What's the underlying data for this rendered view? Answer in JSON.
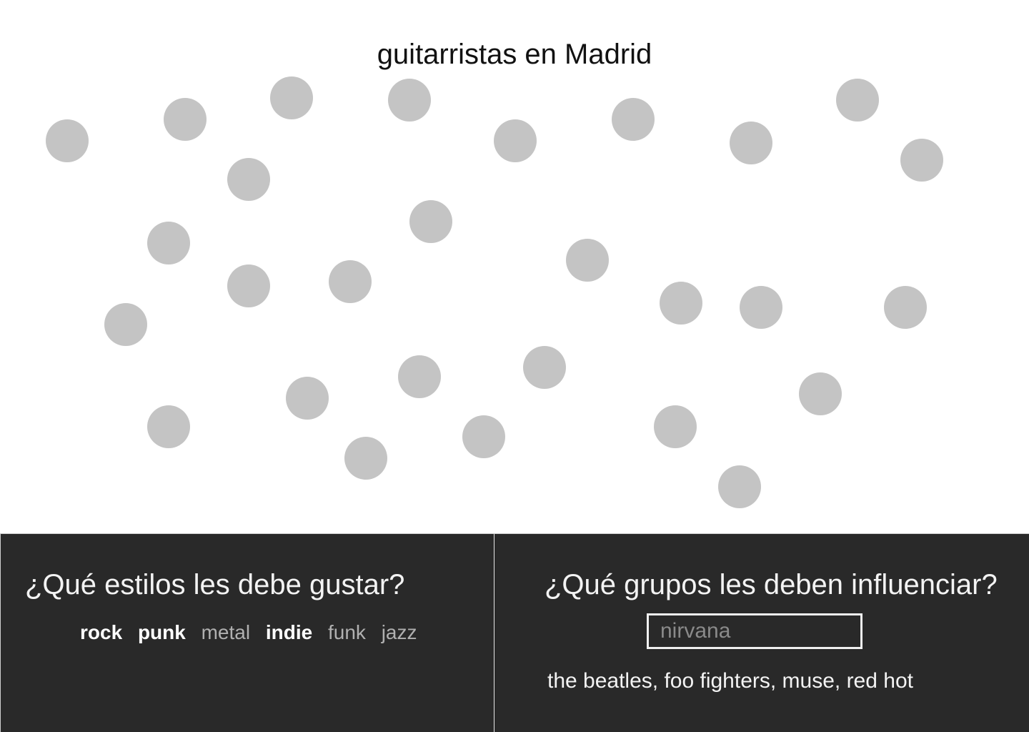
{
  "title": "guitarristas en Madrid",
  "dot_color": "#c4c4c4",
  "panel_color": "#292929",
  "styles_panel": {
    "question": "¿Qué estilos les debe gustar?",
    "styles": [
      {
        "label": "rock",
        "selected": true
      },
      {
        "label": "punk",
        "selected": true
      },
      {
        "label": "metal",
        "selected": false
      },
      {
        "label": "indie",
        "selected": true
      },
      {
        "label": "funk",
        "selected": false
      },
      {
        "label": "jazz",
        "selected": false
      }
    ]
  },
  "bands_panel": {
    "question": "¿Qué grupos les deben influenciar?",
    "input_value": "",
    "input_placeholder": "nirvana",
    "selected_bands": "the beatles, foo fighters, muse, red hot"
  }
}
